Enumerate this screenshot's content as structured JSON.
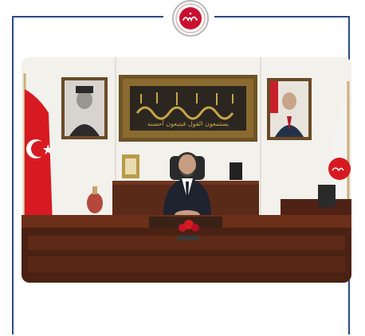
{
  "logo": {
    "icon": "diyanet-emblem-icon",
    "color": "#c8102e"
  },
  "frame": {
    "border_color": "#2b4a86"
  },
  "photo": {
    "description_icon": "official-office-photo",
    "flag_color": "#d71a21",
    "desk_color": "#5a2a18",
    "frame_gold": "#8a6a2e",
    "calligraphy": "يستمعون القول فيتبعون أحسنه"
  }
}
